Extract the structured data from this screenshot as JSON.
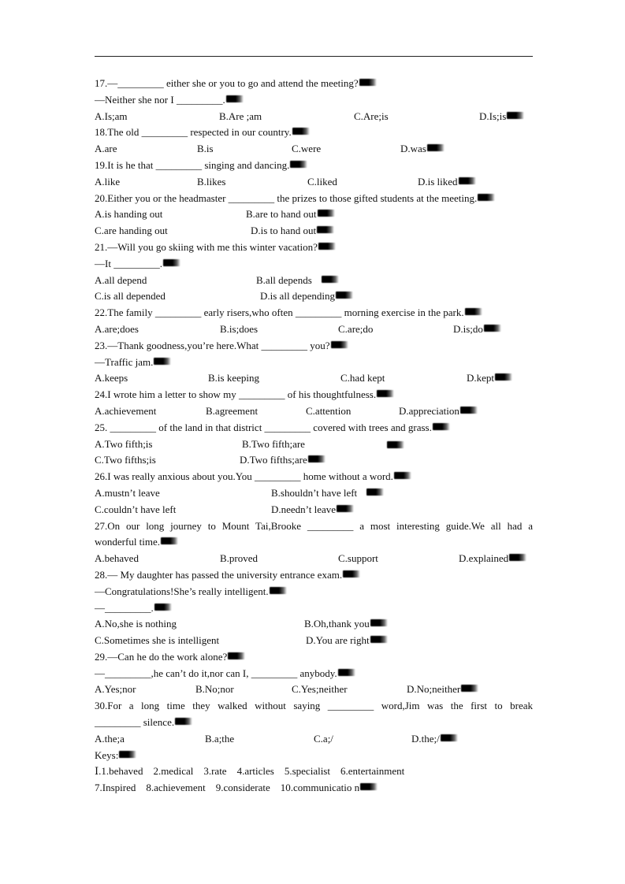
{
  "questions": [
    {
      "num": "17",
      "lines": [
        "17.—_________ either she or you to go and attend the meeting?",
        "—Neither she nor I _________."
      ],
      "options": [
        "A.Is;am",
        "B.Are ;am",
        "C.Are;is",
        "D.Is;is"
      ]
    },
    {
      "num": "18",
      "lines": [
        "18.The old _________ respected in our country."
      ],
      "options": [
        "A.are",
        "B.is",
        "C.were",
        "D.was"
      ]
    },
    {
      "num": "19",
      "lines": [
        "19.It is he that _________ singing and dancing."
      ],
      "options": [
        "A.like",
        "B.likes",
        "C.liked",
        "D.is liked"
      ]
    },
    {
      "num": "20",
      "lines": [
        "20.Either you or the headmaster _________ the prizes to those gifted students at the meeting."
      ],
      "options": [
        "A.is handing out",
        "B.are to hand out",
        "C.are handing out",
        "D.is to hand out"
      ]
    },
    {
      "num": "21",
      "lines": [
        "21.—Will you go skiing with me this winter vacation?",
        "—It _________."
      ],
      "options": [
        "A.all depend",
        "B.all depends",
        "C.is all depended",
        "D.is all depending"
      ]
    },
    {
      "num": "22",
      "lines": [
        "22.The family _________ early risers,who often _________ morning exercise in the park."
      ],
      "options": [
        "A.are;does",
        "B.is;does",
        "C.are;do",
        "D.is;do"
      ]
    },
    {
      "num": "23",
      "lines": [
        "23.—Thank goodness,you’re here.What _________ you?",
        "—Traffic jam."
      ],
      "options": [
        "A.keeps",
        "B.is keeping",
        "C.had kept",
        "D.kept"
      ]
    },
    {
      "num": "24",
      "lines": [
        "24.I wrote him a letter to show my _________ of his thoughtfulness."
      ],
      "options": [
        "A.achievement",
        "B.agreement",
        "C.attention",
        "D.appreciation"
      ]
    },
    {
      "num": "25",
      "lines": [
        "25. _________ of the land in that district _________ covered with trees and grass."
      ],
      "options": [
        "A.Two fifth;is",
        "B.Two fifth;are",
        "C.Two fifths;is",
        "D.Two fifths;are"
      ]
    },
    {
      "num": "26",
      "lines": [
        "26.I was really anxious about you.You _________ home without a word."
      ],
      "options": [
        "A.mustn’t leave",
        "B.shouldn’t have left",
        "C.couldn’t have left",
        "D.needn’t leave"
      ]
    },
    {
      "num": "27",
      "lines": [
        "27.On our long journey to Mount Tai,Brooke _________ a most interesting guide.We all had a",
        "wonderful time."
      ],
      "options": [
        "A.behaved",
        "B.proved",
        "C.support",
        "D.explained"
      ]
    },
    {
      "num": "28",
      "lines": [
        "28.— My daughter has passed the university entrance exam.",
        "—Congratulations!She’s really intelligent.",
        "—_________."
      ],
      "options": [
        "A.No,she is nothing",
        "B.Oh,thank you",
        "C.Sometimes she is intelligent",
        "D.You are right"
      ]
    },
    {
      "num": "29",
      "lines": [
        "29.—Can he do the work alone?",
        "—_________,he can’t do it,nor can I, _________ anybody."
      ],
      "options": [
        "A.Yes;nor",
        "B.No;nor",
        "C.Yes;neither",
        "D.No;neither"
      ]
    },
    {
      "num": "30",
      "lines": [
        "30.For a long time they walked without saying _________ word,Jim was the first to break",
        "_________ silence."
      ],
      "options": [
        "A.the;a",
        "B.a;the",
        "C.a;/",
        "D.the;/"
      ]
    }
  ],
  "keys": {
    "title": "Keys:",
    "line1": "Ⅰ.1.behaved    2.medical    3.rate    4.articles    5.specialist    6.entertainment",
    "line2": "7.Inspired    8.achievement    9.considerate    10.communicatio n"
  }
}
